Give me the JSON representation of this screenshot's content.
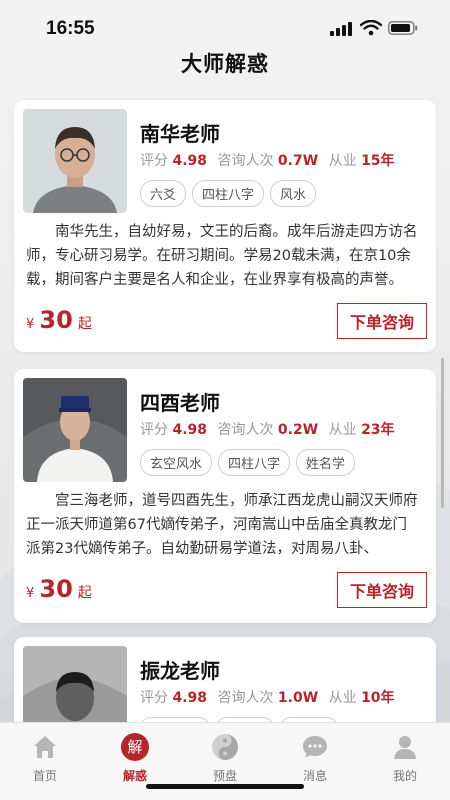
{
  "status_bar": {
    "time": "16:55"
  },
  "page": {
    "title": "大师解惑"
  },
  "masters": [
    {
      "name": "南华老师",
      "rating_label": "评分",
      "rating": "4.98",
      "consult_label": "咨询人次",
      "consults": "0.7W",
      "years_label": "从业",
      "years": "15年",
      "tags": [
        "六爻",
        "四柱八字",
        "风水"
      ],
      "description": "南华先生，自幼好易，文王的后裔。成年后游走四方访名师，专心研习易学。在研习期间。学易20载未满，在京10余载，期间客户主要是名人和企业，在业界享有极高的声誉。",
      "price_currency": "¥",
      "price": "30",
      "price_suffix": "起",
      "button": "下单咨询"
    },
    {
      "name": "四酉老师",
      "rating_label": "评分",
      "rating": "4.98",
      "consult_label": "咨询人次",
      "consults": "0.2W",
      "years_label": "从业",
      "years": "23年",
      "tags": [
        "玄空风水",
        "四柱八字",
        "姓名学"
      ],
      "description": "宫三海老师，道号四酉先生，师承江西龙虎山嗣汉天师府正一派天师道第67代嫡传弟子，河南嵩山中岳庙全真教龙门 派第23代嫡传弟子。自幼勤研易学道法，对周易八卦、",
      "price_currency": "¥",
      "price": "30",
      "price_suffix": "起",
      "button": "下单咨询"
    },
    {
      "name": "振龙老师",
      "rating_label": "评分",
      "rating": "4.98",
      "consult_label": "咨询人次",
      "consults": "1.0W",
      "years_label": "从业",
      "years": "10年",
      "tags": [
        "",
        "",
        ""
      ]
    }
  ],
  "tabbar": {
    "items": [
      {
        "label": "首页",
        "icon": "home-icon"
      },
      {
        "label": "解惑",
        "icon": "jie-icon",
        "glyph": "解"
      },
      {
        "label": "预盘",
        "icon": "yin-yang-icon"
      },
      {
        "label": "消息",
        "icon": "chat-bubble-icon"
      },
      {
        "label": "我的",
        "icon": "person-icon"
      }
    ],
    "active_index": 1
  },
  "colors": {
    "accent": "#b8242a",
    "background": "#eeeeee"
  }
}
